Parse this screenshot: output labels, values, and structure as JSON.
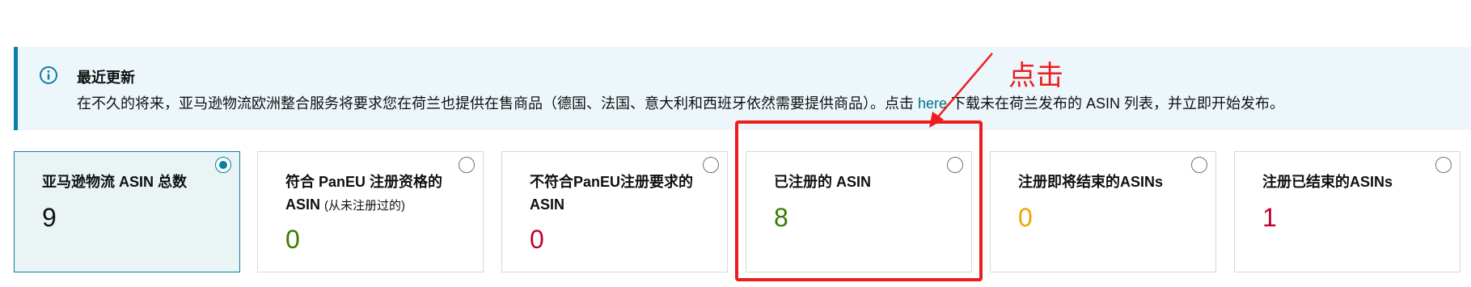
{
  "banner": {
    "title": "最近更新",
    "text_before": "在不久的将来，亚马逊物流欧洲整合服务将要求您在荷兰也提供在售商品（德国、法国、意大利和西班牙依然需要提供商品）。点击 ",
    "link": "here",
    "text_after": " 下载未在荷兰发布的 ASIN 列表，并立即开始发布。",
    "icon": "info-icon",
    "accent_color": "#0a7ea4",
    "background_color": "#edf7fb"
  },
  "cards": [
    {
      "title": "亚马逊物流 ASIN 总数",
      "subtitle": "",
      "value": "9",
      "value_color": "#0f1111",
      "selected": true
    },
    {
      "title": "符合 PanEU 注册资格的 ASIN",
      "subtitle": "(从未注册过的)",
      "value": "0",
      "value_color": "#3a7a00",
      "selected": false
    },
    {
      "title": "不符合PanEU注册要求的 ASIN",
      "subtitle": "",
      "value": "0",
      "value_color": "#c40030",
      "selected": false
    },
    {
      "title": "已注册的 ASIN",
      "subtitle": "",
      "value": "8",
      "value_color": "#3a7a00",
      "selected": false
    },
    {
      "title": "注册即将结束的ASINs",
      "subtitle": "",
      "value": "0",
      "value_color": "#f0a500",
      "selected": false
    },
    {
      "title": "注册已结束的ASINs",
      "subtitle": "",
      "value": "1",
      "value_color": "#c40030",
      "selected": false
    }
  ],
  "annotation": {
    "label": "点击",
    "color": "#ee1c1c"
  }
}
